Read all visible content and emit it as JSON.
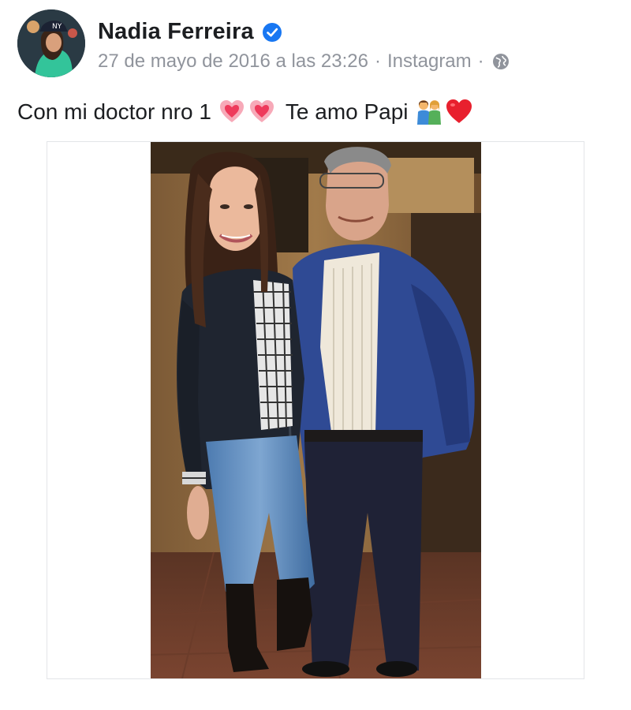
{
  "post": {
    "author_name": "Nadia Ferreira",
    "date": "27 de mayo de 2016 a las 23:26",
    "separator": "·",
    "source": "Instagram",
    "caption_part1": "Con mi doctor nro 1",
    "caption_part2": "Te amo Papi"
  },
  "icons": {
    "verified": "verified-badge-icon",
    "privacy": "globe-icon",
    "emojis": [
      "heart-emoji",
      "heart-emoji",
      "couple-emoji",
      "red-heart-emoji"
    ]
  },
  "colors": {
    "name_text": "#1c1e21",
    "meta_text": "#90949c",
    "verified_blue": "#1877f2"
  }
}
